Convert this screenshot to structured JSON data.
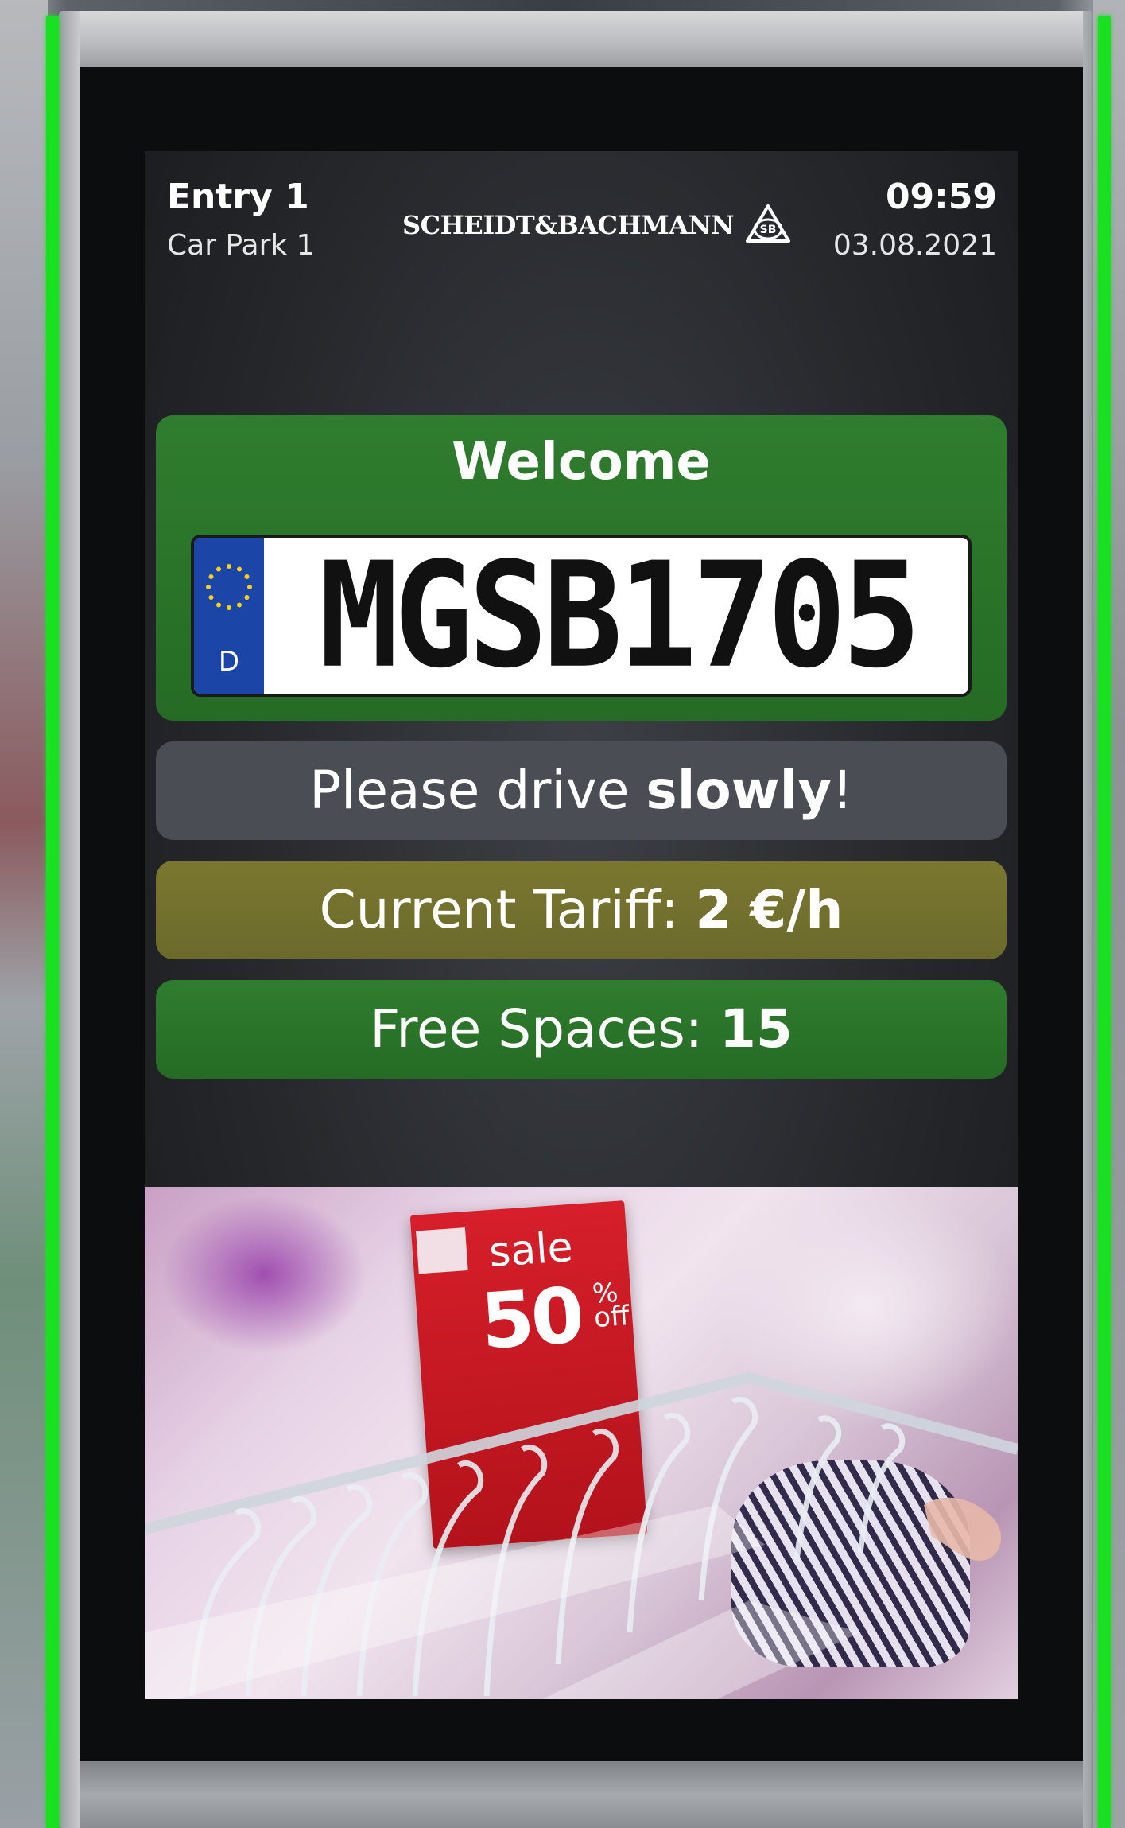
{
  "header": {
    "entry_title": "Entry 1",
    "entry_subtitle": "Car Park 1",
    "brand": "SCHEIDT&BACHMANN",
    "brand_logo": "sb-logo-icon",
    "time": "09:59",
    "date": "03.08.2021"
  },
  "welcome": {
    "title": "Welcome",
    "plate_country": "D",
    "plate_number": "MGSB1705"
  },
  "messages": {
    "drive_prefix": "Please drive ",
    "drive_bold": "slowly",
    "drive_suffix": "!",
    "tariff_label": "Current Tariff: ",
    "tariff_value": "2 €/h",
    "spaces_label": "Free Spaces: ",
    "spaces_value": "15"
  },
  "ad": {
    "sale_word": "sale",
    "sale_number": "50",
    "sale_percent": "%",
    "sale_off": "off"
  },
  "colors": {
    "indicator_green": "#19e021",
    "panel_green": "#2f7d2e",
    "panel_gray": "#4a4d54",
    "panel_olive": "#7a7730",
    "eu_blue": "#1c45a8",
    "sale_red": "#d61f2a"
  }
}
